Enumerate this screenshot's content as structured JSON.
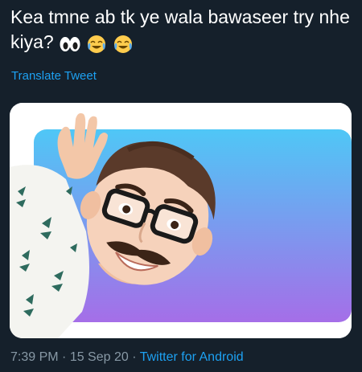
{
  "tweet": {
    "text": "Kea tmne ab tk ye wala bawaseer try nhe kiya?",
    "emojis": [
      "eyes-icon",
      "joy-icon",
      "joy-icon"
    ]
  },
  "translate_label": "Translate Tweet",
  "meta": {
    "time": "7:39 PM",
    "separator1": " · ",
    "date": "15 Sep 20",
    "separator2": " · ",
    "source": "Twitter for Android"
  },
  "colors": {
    "background": "#15202b",
    "link": "#1da1f2",
    "meta_text": "#8899a6",
    "gradient_top": "#4fc7f6",
    "gradient_bottom": "#a56ee8"
  }
}
